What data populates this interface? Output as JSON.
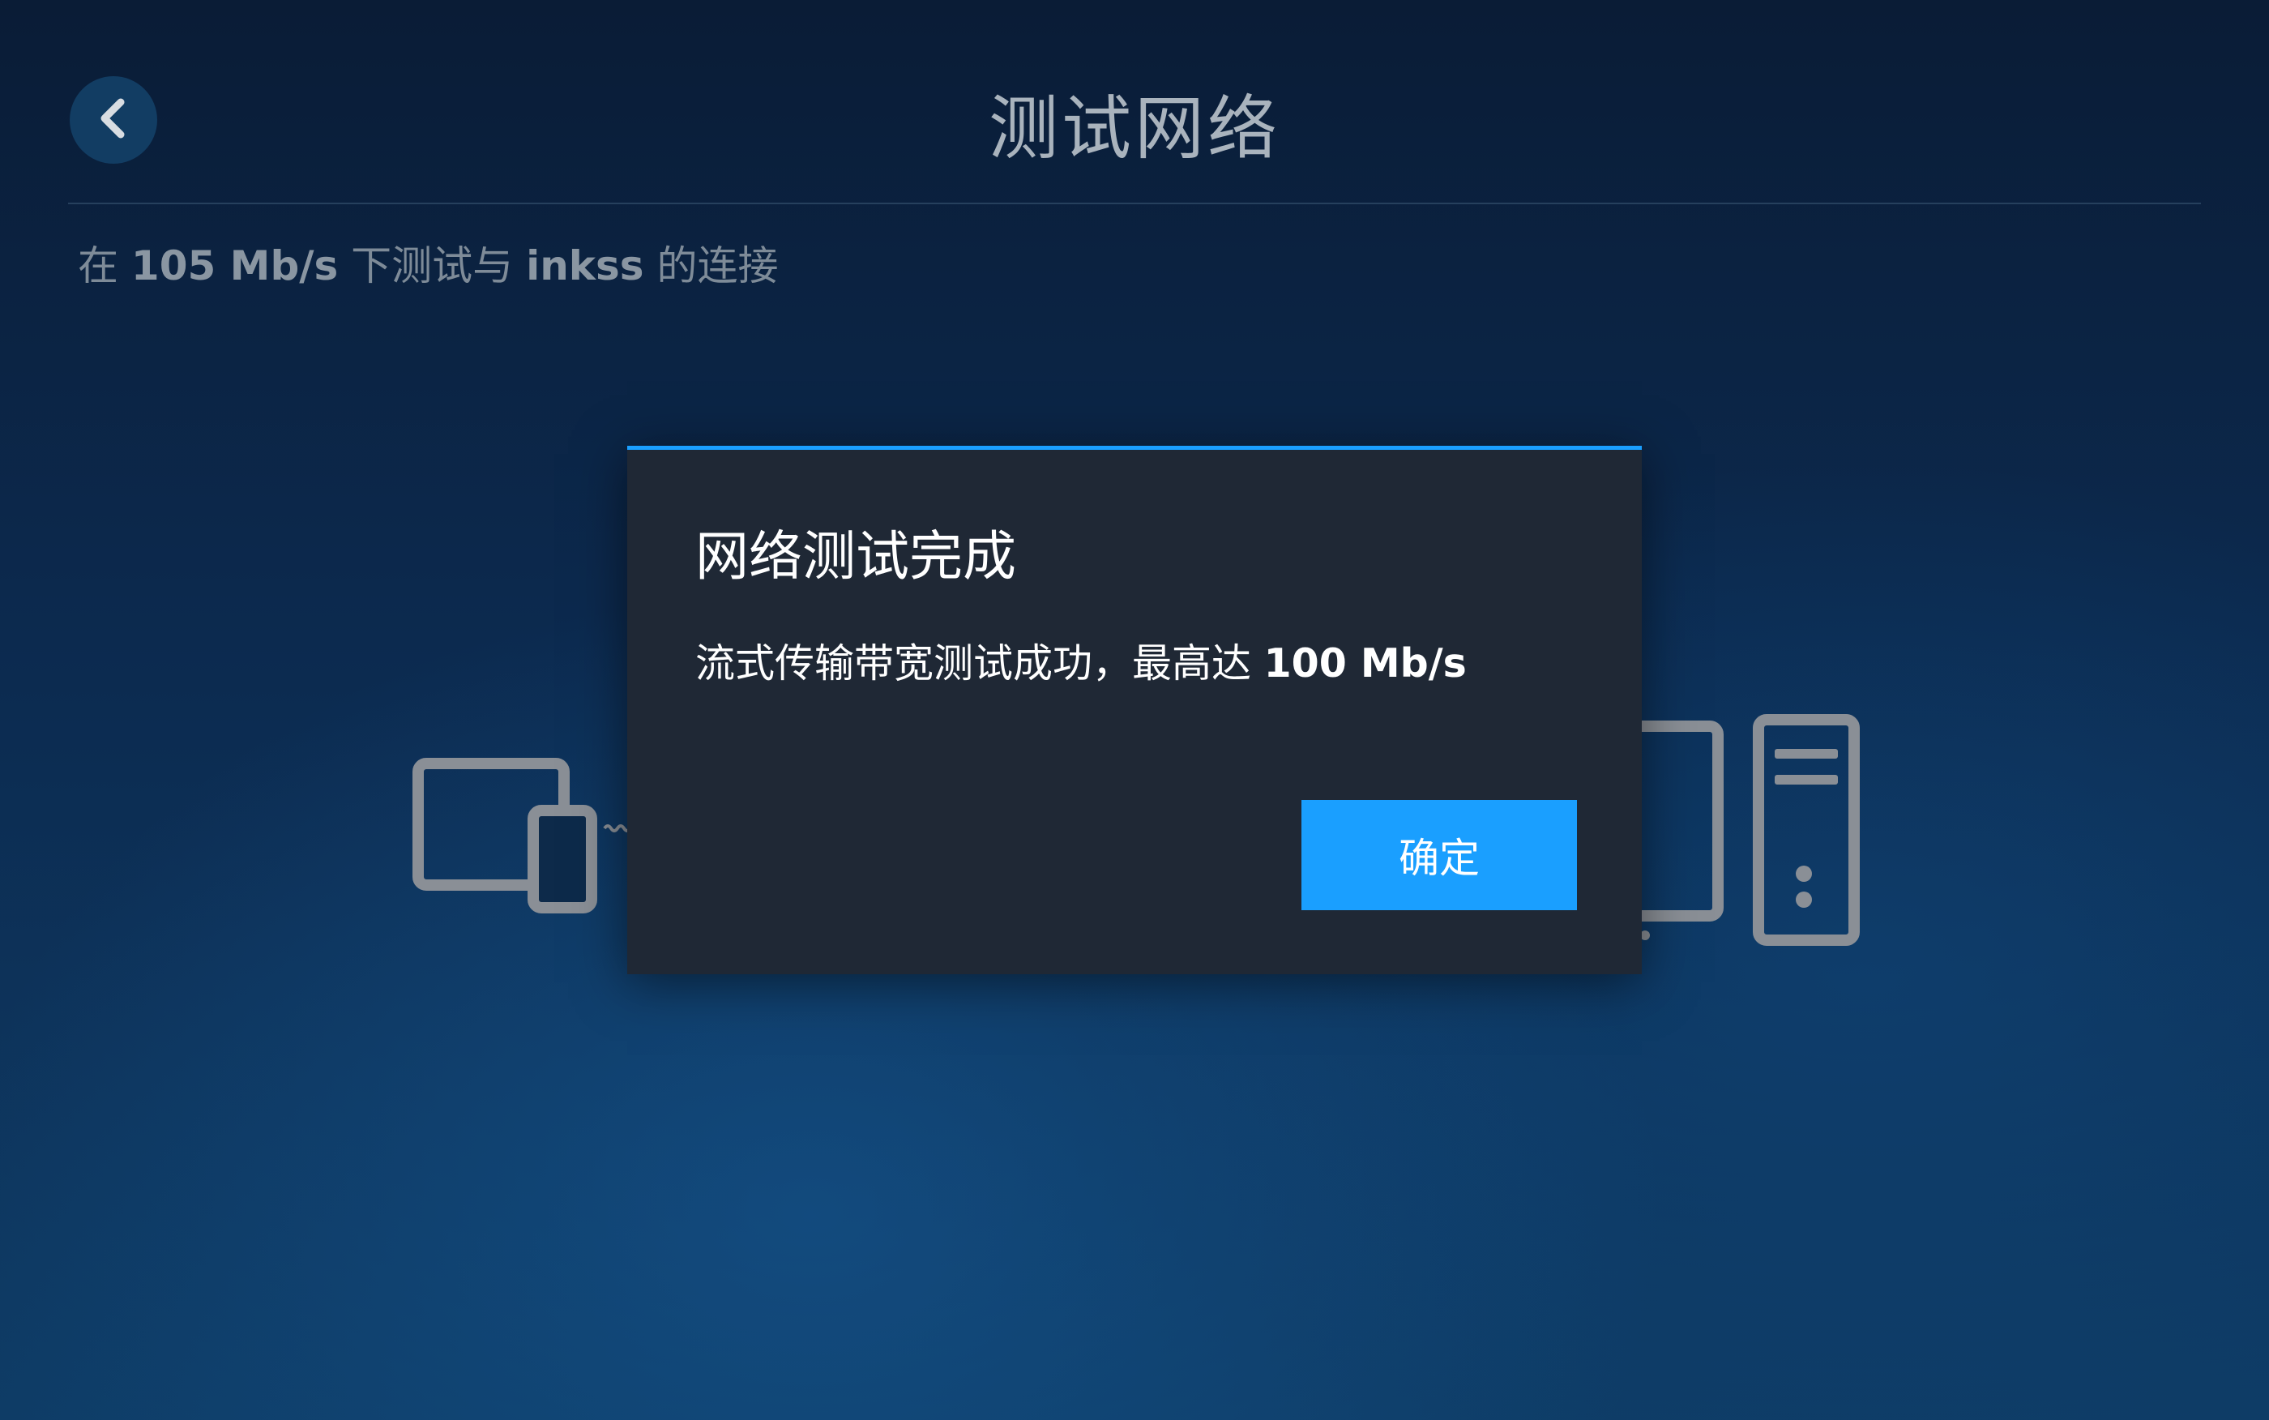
{
  "header": {
    "title": "测试网络",
    "back_icon": "chevron-left-icon"
  },
  "subtitle": {
    "prefix": "在 ",
    "speed": "105 Mb/s",
    "middle": " 下测试与 ",
    "host": "inkss",
    "suffix": " 的连接"
  },
  "illustration": {
    "client_icon": "tablet-phone-icon",
    "server_icon": "desktop-tower-icon",
    "link_icon": "signal-wave-icon"
  },
  "dialog": {
    "title": "网络测试完成",
    "message_prefix": "流式传输带宽测试成功，最高达 ",
    "message_value": "100 Mb/s",
    "ok_label": "确定"
  },
  "colors": {
    "accent": "#1a9fff",
    "dialog_bg": "#1f2835",
    "icon_gray": "#8a8f96"
  }
}
